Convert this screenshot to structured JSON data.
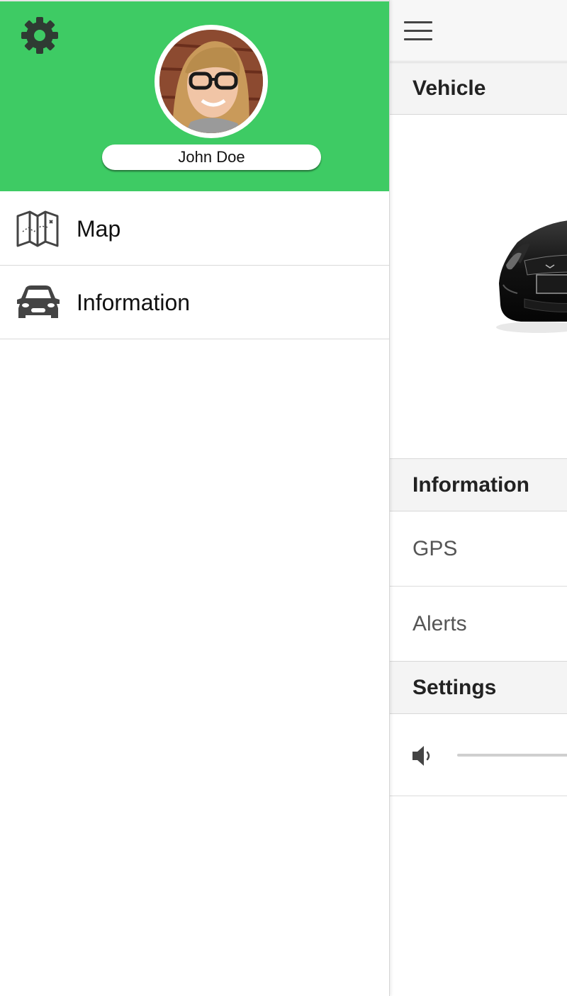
{
  "drawer": {
    "user_name": "John Doe",
    "accent_color": "#3ecb64",
    "settings_icon": "gear-icon",
    "nav_items": [
      {
        "label": "Map",
        "icon": "map-icon"
      },
      {
        "label": "Information",
        "icon": "car-icon"
      }
    ]
  },
  "main": {
    "menu_icon": "hamburger-menu-icon",
    "sections": {
      "vehicle": {
        "title": "Vehicle"
      },
      "information": {
        "title": "Information",
        "items": [
          {
            "label": "GPS"
          },
          {
            "label": "Alerts"
          }
        ]
      },
      "settings": {
        "title": "Settings",
        "volume_icon": "volume-icon"
      }
    }
  }
}
